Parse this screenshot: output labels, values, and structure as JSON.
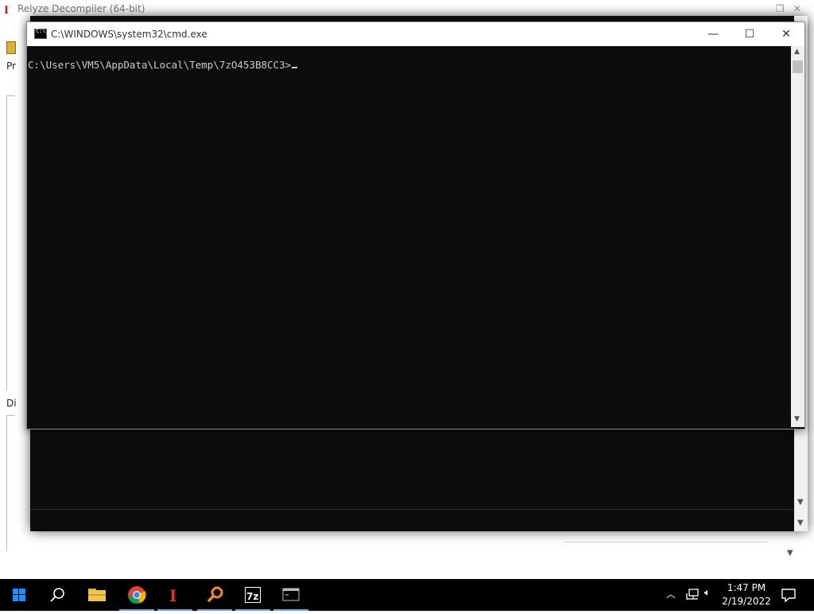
{
  "background_app": {
    "title": "Relyze Decompiler (64-bit)",
    "menu_fragment": "Pr",
    "panel_label_fragment": "Di"
  },
  "cmd_window": {
    "title": "C:\\WINDOWS\\system32\\cmd.exe",
    "prompt": "C:\\Users\\VM5\\AppData\\Local\\Temp\\7zO453B8CC3>",
    "controls": {
      "minimize": "—",
      "maximize": "☐",
      "close": "✕"
    }
  },
  "taskbar": {
    "items": [
      {
        "name": "start",
        "icon": "windows-logo-icon"
      },
      {
        "name": "search",
        "icon": "search-icon"
      },
      {
        "name": "file-explorer",
        "icon": "folder-icon"
      },
      {
        "name": "chrome",
        "icon": "chrome-icon"
      },
      {
        "name": "ida",
        "icon": "ida-icon"
      },
      {
        "name": "search-tool",
        "icon": "magnifier-icon"
      },
      {
        "name": "7zip",
        "icon": "7zip-icon",
        "label": "7z"
      },
      {
        "name": "cmd",
        "icon": "console-icon"
      }
    ],
    "time": "1:47 PM",
    "date": "2/19/2022"
  },
  "colors": {
    "console_bg": "#0c0c0c",
    "console_text": "#cccccc",
    "taskbar_bg": "#000000",
    "active_underline": "#6fa8dc"
  }
}
